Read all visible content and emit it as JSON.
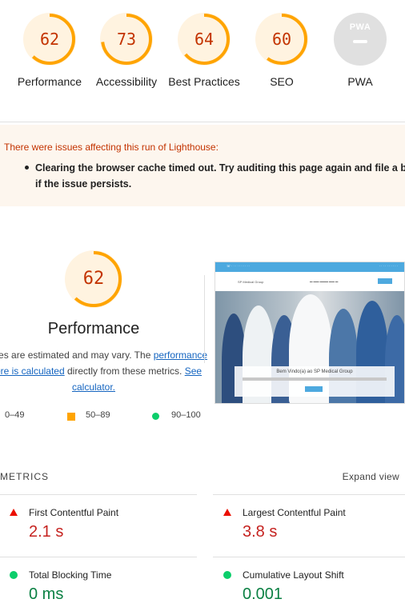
{
  "colors": {
    "average_orange": "#ffa400",
    "average_text": "#c33300",
    "fail_red": "#eb0f00",
    "pass_green": "#0cce6b",
    "link_blue": "#1565c0"
  },
  "categories": [
    {
      "score": "62",
      "fraction": 0.62,
      "label": "Performance"
    },
    {
      "score": "73",
      "fraction": 0.73,
      "label": "Accessibility"
    },
    {
      "score": "64",
      "fraction": 0.64,
      "label": "Best Practices"
    },
    {
      "score": "60",
      "fraction": 0.6,
      "label": "SEO"
    },
    {
      "score": "",
      "label": "PWA",
      "badge": "PWA"
    }
  ],
  "warning": {
    "title": "There were issues affecting this run of Lighthouse:",
    "items": [
      "Clearing the browser cache timed out. Try auditing this page again and file a bug if the issue persists."
    ]
  },
  "performance": {
    "score": "62",
    "fraction": 0.62,
    "title": "Performance",
    "desc_prefix": "Values are estimated and may vary. The ",
    "desc_link": "performance score is calculated",
    "desc_middle": " directly from these metrics. ",
    "calc_link": "See calculator."
  },
  "legend": {
    "fail": "0–49",
    "average": "50–89",
    "pass": "90–100"
  },
  "screenshot": {
    "hero_title": "Bem Vindo(a) ao SP Medical Group",
    "logo": "SP Medical Group"
  },
  "metrics": {
    "header": "METRICS",
    "expand": "Expand view",
    "items": [
      {
        "name": "First Contentful Paint",
        "value": "2.1 s",
        "status": "fail"
      },
      {
        "name": "Largest Contentful Paint",
        "value": "3.8 s",
        "status": "fail"
      },
      {
        "name": "Total Blocking Time",
        "value": "0 ms",
        "status": "pass"
      },
      {
        "name": "Cumulative Layout Shift",
        "value": "0.001",
        "status": "pass"
      }
    ]
  }
}
